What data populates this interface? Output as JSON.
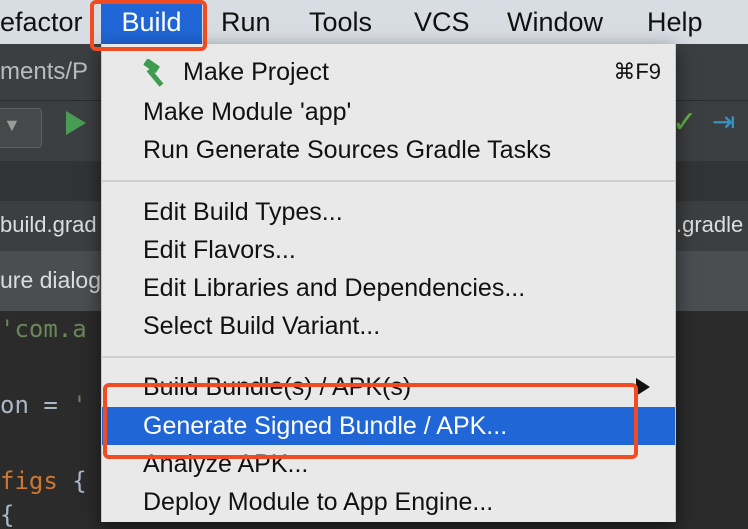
{
  "menubar": {
    "items": [
      "efactor",
      "Build",
      "Run",
      "Tools",
      "VCS",
      "Window",
      "Help"
    ],
    "active": "Build"
  },
  "ide": {
    "path_fragment": "ments/P",
    "tab_left": "build.grad",
    "tab_right": ".gradle (",
    "banner_fragment": "ure dialog",
    "code_line1": "'com.a",
    "code_line2_a": "on = ",
    "code_line2_b": "'",
    "code_line3_a": "figs",
    "code_line3_b": " {",
    "code_line4": "{"
  },
  "build_menu": {
    "make_project": "Make Project",
    "make_project_shortcut": "⌘F9",
    "make_module": "Make Module 'app'",
    "run_generate_sources": "Run Generate Sources Gradle Tasks",
    "edit_build_types": "Edit Build Types...",
    "edit_flavors": "Edit Flavors...",
    "edit_libraries": "Edit Libraries and Dependencies...",
    "select_build_variant": "Select Build Variant...",
    "build_bundle_apk": "Build Bundle(s) / APK(s)",
    "generate_signed": "Generate Signed Bundle / APK...",
    "analyze_apk": "Analyze APK...",
    "deploy_module": "Deploy Module to App Engine..."
  },
  "colors": {
    "highlight": "#2066d6",
    "annotation": "#f04b23"
  }
}
